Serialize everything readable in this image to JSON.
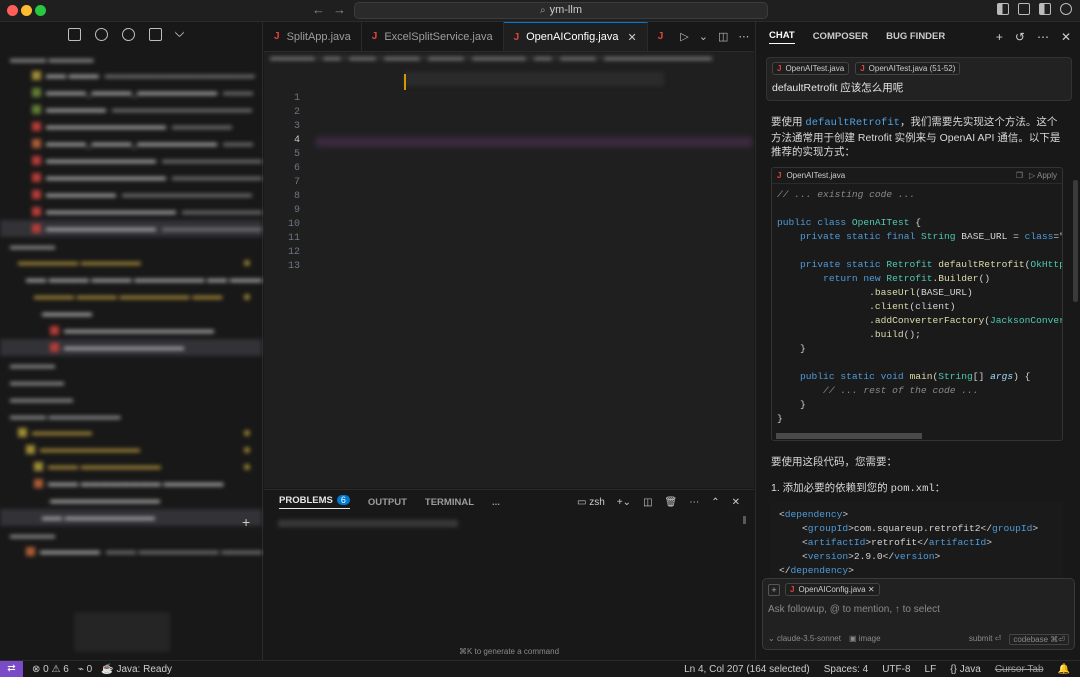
{
  "window": {
    "title": "ym-llm",
    "colors": {
      "accent": "#0078d4",
      "close": "#ff5f57",
      "minimize": "#febc2e",
      "zoom": "#28c840",
      "java_icon": "#e0443e"
    }
  },
  "tabs": [
    {
      "label": "SplitApp.java",
      "active": false
    },
    {
      "label": "ExcelSplitService.java",
      "active": false
    },
    {
      "label": "OpenAIConfig.java",
      "active": true
    },
    {
      "label": "J",
      "active": false
    }
  ],
  "editor": {
    "line_numbers": [
      "1",
      "2",
      "3",
      "4",
      "5",
      "6",
      "7",
      "8",
      "9",
      "10",
      "11",
      "12",
      "13"
    ],
    "current_line": "4"
  },
  "panel": {
    "tabs": [
      "PROBLEMS",
      "OUTPUT",
      "TERMINAL",
      "..."
    ],
    "problems_count": "6",
    "terminal_name": "zsh",
    "cmdk_hint": "⌘K to generate a command"
  },
  "chat": {
    "tabs": [
      "CHAT",
      "COMPOSER",
      "BUG FINDER"
    ],
    "context_pills": [
      "OpenAITest.java",
      "OpenAITest.java (51-52)"
    ],
    "question": "defaultRetrofit 应该怎么用呢",
    "answer_intro_pre": "要使用 ",
    "answer_intro_code": "defaultRetrofit",
    "answer_intro_post": "，我们需要先实现这个方法。这个方法通常用于创建 Retrofit 实例来与 OpenAI API 通信。以下是推荐的实现方式：",
    "code_file": "OpenAITest.java",
    "code_apply": "Apply",
    "code_lines": [
      "// ... existing code ...",
      "",
      "public class OpenAITest {",
      "    private static final String BASE_URL = \"https:",
      "",
      "    private static Retrofit defaultRetrofit(OkHttp",
      "        return new Retrofit.Builder()",
      "                .baseUrl(BASE_URL)",
      "                .client(client)",
      "                .addConverterFactory(JacksonConver",
      "                .build();",
      "    }",
      "",
      "    public static void main(String[] args) {",
      "        // ... rest of the code ...",
      "    }",
      "}"
    ],
    "usage_text": "要使用这段代码，您需要：",
    "step1_pre": "1. 添加必要的依赖到您的 ",
    "step1_code": "pom.xml",
    "step1_post": "：",
    "xml": {
      "groupId": "com.squareup.retrofit2",
      "artifactId": "retrofit",
      "version": "2.9.0"
    },
    "composer": {
      "pill": "OpenAIConfig.java",
      "placeholder": "Ask followup, @ to mention, ↑ to select",
      "model": "claude-3.5-sonnet",
      "image": "image",
      "submit": "submit ⏎",
      "codebase": "codebase ⌘⏎"
    }
  },
  "status": {
    "errors": "0",
    "warnings": "6",
    "ports": "0",
    "java": "Java: Ready",
    "position": "Ln 4, Col 207 (164 selected)",
    "spaces": "Spaces: 4",
    "encoding": "UTF-8",
    "eol": "LF",
    "language": "Java",
    "cursor_tab": "Cursor Tab"
  }
}
